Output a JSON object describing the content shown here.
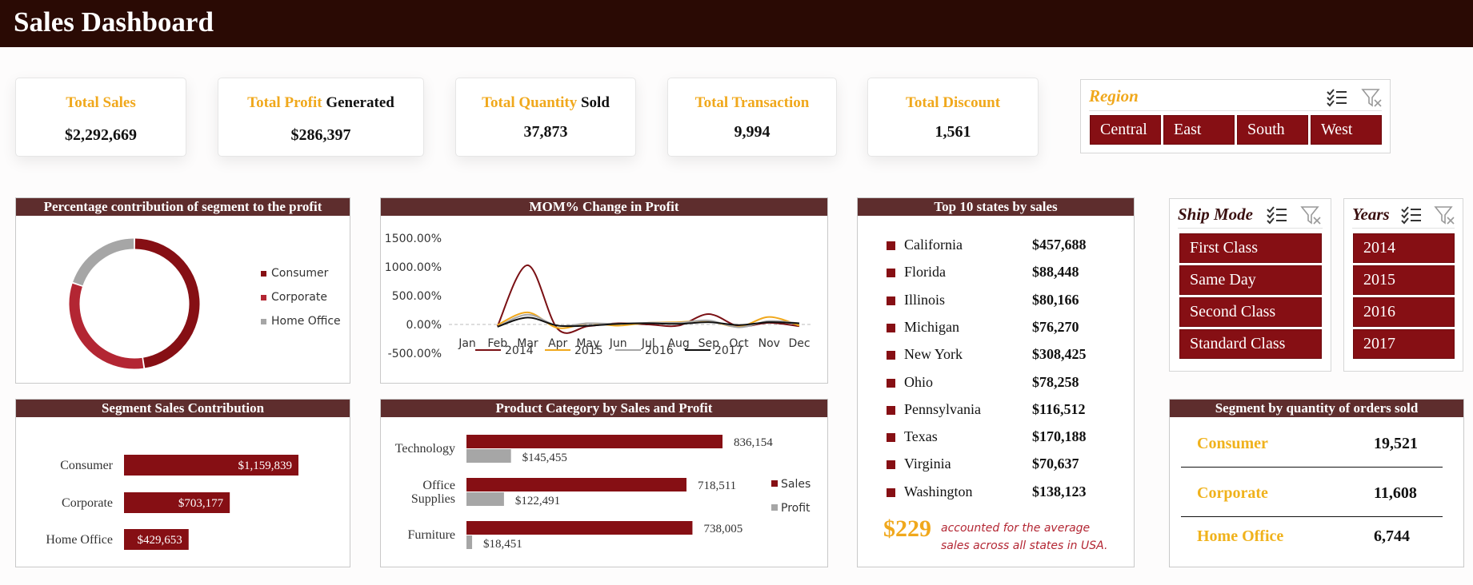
{
  "header": {
    "title": "Sales Dashboard"
  },
  "colors": {
    "primary": "#860f14",
    "accent": "#f0a81c",
    "header_bg": "#2a0a04",
    "panel_head": "#5e2d2d",
    "gray": "#a6a6a6"
  },
  "kpis": [
    {
      "label": "Total Sales",
      "suffix": "",
      "value": "$2,292,669"
    },
    {
      "label": "Total Profit",
      "suffix": " Generated",
      "value": "$286,397"
    },
    {
      "label": "Total Quantity",
      "suffix": " Sold",
      "value": "37,873"
    },
    {
      "label": "Total Transaction",
      "suffix": "",
      "value": "9,994"
    },
    {
      "label": "Total Discount",
      "suffix": "",
      "value": "1,561"
    }
  ],
  "region_slicer": {
    "title": "Region",
    "options": [
      "Central",
      "East",
      "South",
      "West"
    ],
    "icons": [
      "multi-select-icon",
      "clear-filter-icon"
    ]
  },
  "ship_mode_slicer": {
    "title": "Ship Mode",
    "options": [
      "First Class",
      "Same Day",
      "Second Class",
      "Standard Class"
    ],
    "icons": [
      "multi-select-icon",
      "clear-filter-icon"
    ]
  },
  "years_slicer": {
    "title": "Years",
    "options": [
      "2014",
      "2015",
      "2016",
      "2017"
    ],
    "icons": [
      "multi-select-icon",
      "clear-filter-icon"
    ]
  },
  "panels": {
    "donut": {
      "title": "Percentage contribution of segment to the profit"
    },
    "mom": {
      "title": "MOM% Change in Profit"
    },
    "top_states": {
      "title": "Top 10 states by sales"
    },
    "segment_sales": {
      "title": "Segment Sales Contribution"
    },
    "product": {
      "title": "Product Category by Sales and Profit"
    },
    "segment_qty": {
      "title": "Segment by quantity of orders sold"
    }
  },
  "top_states": {
    "rows": [
      {
        "state": "California",
        "value": "$457,688"
      },
      {
        "state": "Florida",
        "value": "$88,448"
      },
      {
        "state": "Illinois",
        "value": "$80,166"
      },
      {
        "state": "Michigan",
        "value": "$76,270"
      },
      {
        "state": "New York",
        "value": "$308,425"
      },
      {
        "state": "Ohio",
        "value": "$78,258"
      },
      {
        "state": "Pennsylvania",
        "value": "$116,512"
      },
      {
        "state": "Texas",
        "value": "$170,188"
      },
      {
        "state": "Virginia",
        "value": "$70,637"
      },
      {
        "state": "Washington",
        "value": "$138,123"
      }
    ],
    "avg_value": "$229",
    "avg_text_1": "accounted for the average",
    "avg_text_2": "sales across all states in USA."
  },
  "segment_qty": {
    "rows": [
      {
        "segment": "Consumer",
        "value": "19,521"
      },
      {
        "segment": "Corporate",
        "value": "11,608"
      },
      {
        "segment": "Home Office",
        "value": "6,744"
      }
    ]
  },
  "chart_data": [
    {
      "type": "donut",
      "series": [
        {
          "name": "Consumer",
          "value": 47.6,
          "color": "#860f14"
        },
        {
          "name": "Corporate",
          "value": 32.6,
          "color": "#b32633"
        },
        {
          "name": "Home Office",
          "value": 19.8,
          "color": "#a6a6a6"
        }
      ],
      "legend": "right"
    },
    {
      "type": "line",
      "categories": [
        "Jan",
        "Feb",
        "Mar",
        "Apr",
        "May",
        "Jun",
        "Jul",
        "Aug",
        "Sep",
        "Oct",
        "Nov",
        "Dec"
      ],
      "y_ticks": [
        "1500.00%",
        "1000.00%",
        "500.00%",
        "0.00%",
        "-500.00%"
      ],
      "ylim": [
        -500,
        1500
      ],
      "series": [
        {
          "name": "2014",
          "color": "#7a1014",
          "values": [
            0,
            -30,
            1030,
            -80,
            -30,
            20,
            0,
            -20,
            180,
            -30,
            30,
            -30
          ]
        },
        {
          "name": "2015",
          "color": "#f0a81c",
          "values": [
            0,
            -10,
            210,
            -60,
            20,
            -20,
            30,
            40,
            60,
            -40,
            130,
            -20
          ]
        },
        {
          "name": "2016",
          "color": "#a6a6a6",
          "values": [
            0,
            -40,
            170,
            -20,
            20,
            10,
            30,
            30,
            70,
            -50,
            60,
            20
          ]
        },
        {
          "name": "2017",
          "color": "#111111",
          "values": [
            0,
            -40,
            120,
            -20,
            -20,
            10,
            20,
            10,
            40,
            -10,
            40,
            20
          ]
        }
      ],
      "legend": "bottom"
    },
    {
      "type": "bar",
      "orientation": "horizontal",
      "categories": [
        "Consumer",
        "Corporate",
        "Home Office"
      ],
      "values": [
        1159839,
        703177,
        429653
      ],
      "labels": [
        "$1,159,839",
        "$703,177",
        "$429,653"
      ]
    },
    {
      "type": "bar",
      "orientation": "horizontal",
      "categories": [
        "Technology",
        "Office Supplies",
        "Furniture"
      ],
      "category_lines": [
        [
          "Technology"
        ],
        [
          "Office",
          "Supplies"
        ],
        [
          "Furniture"
        ]
      ],
      "series": [
        {
          "name": "Sales",
          "color": "#860f14",
          "values": [
            836154,
            718511,
            738005
          ],
          "labels": [
            "836,154",
            "718,511",
            "738,005"
          ]
        },
        {
          "name": "Profit",
          "color": "#a6a6a6",
          "values": [
            145455,
            122491,
            18451
          ],
          "labels": [
            "$145,455",
            "$122,491",
            "$18,451"
          ]
        }
      ],
      "legend": "right"
    }
  ]
}
